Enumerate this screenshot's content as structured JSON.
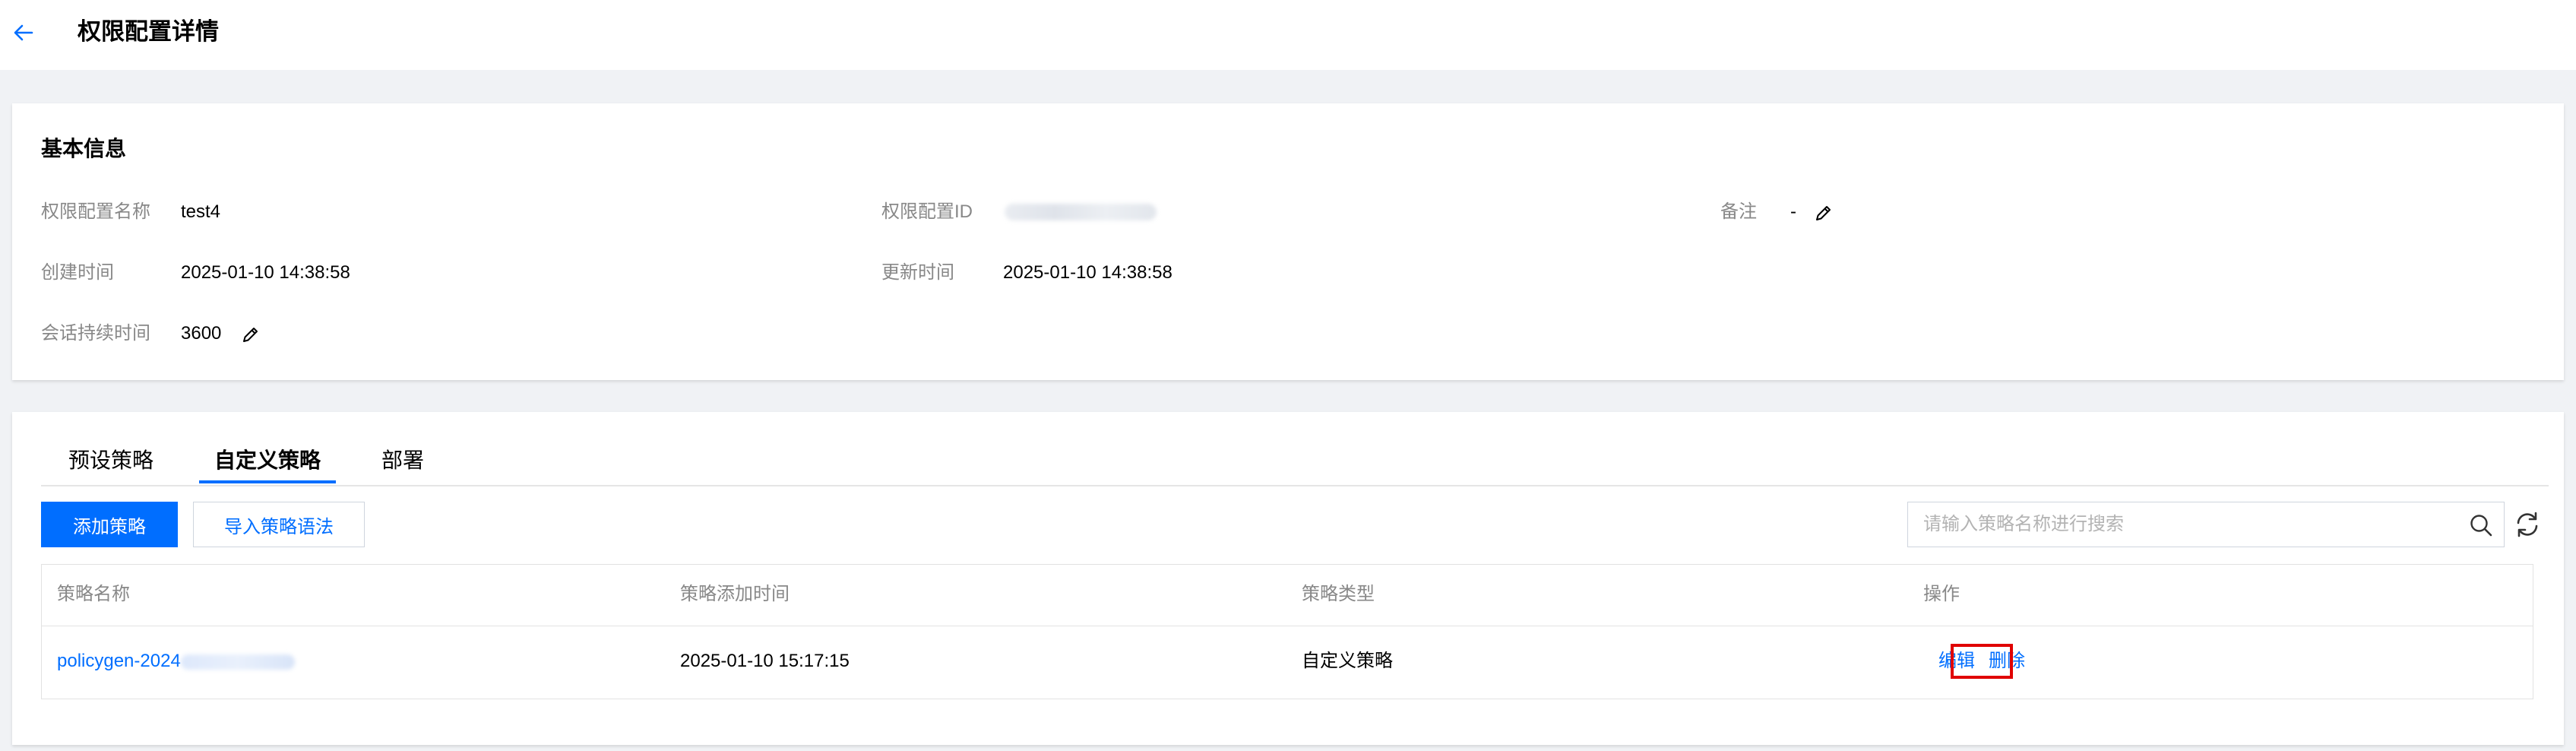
{
  "header": {
    "title": "权限配置详情"
  },
  "basic_info": {
    "title": "基本信息",
    "fields": {
      "name": {
        "label": "权限配置名称",
        "value": "test4"
      },
      "id": {
        "label": "权限配置ID"
      },
      "remark": {
        "label": "备注",
        "value": "-"
      },
      "created": {
        "label": "创建时间",
        "value": "2025-01-10 14:38:58"
      },
      "updated": {
        "label": "更新时间",
        "value": "2025-01-10 14:38:58"
      },
      "session": {
        "label": "会话持续时间",
        "value": "3600"
      }
    }
  },
  "tabs": [
    "预设策略",
    "自定义策略",
    "部署"
  ],
  "active_tab": "自定义策略",
  "toolbar": {
    "add_label": "添加策略",
    "import_label": "导入策略语法",
    "search_placeholder": "请输入策略名称进行搜索"
  },
  "table": {
    "columns": [
      "策略名称",
      "策略添加时间",
      "策略类型",
      "操作"
    ],
    "rows": [
      {
        "name": "policygen-2024",
        "added_time": "2025-01-10 15:17:15",
        "type": "自定义策略",
        "actions": {
          "edit": "编辑",
          "delete": "删除"
        }
      }
    ]
  },
  "colors": {
    "accent": "#006eff",
    "highlight": "#e00000"
  },
  "icons": [
    "back-arrow-icon",
    "pencil-icon",
    "search-icon",
    "refresh-icon"
  ]
}
